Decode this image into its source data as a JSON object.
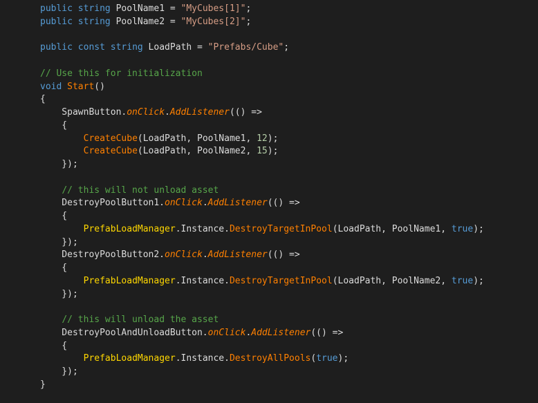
{
  "editor": {
    "theme": "dark",
    "colors": {
      "background": "#1e1e1e",
      "keyword": "#569cd6",
      "plain": "#dcdcdc",
      "string": "#d69d85",
      "comment": "#57a64a",
      "method": "#ff8000",
      "class": "#ffd700",
      "number": "#b5cea8"
    },
    "lines": [
      [
        {
          "t": "kw",
          "v": "public"
        },
        {
          "t": "plain",
          "v": " "
        },
        {
          "t": "kw",
          "v": "string"
        },
        {
          "t": "plain",
          "v": " PoolName1 = "
        },
        {
          "t": "str",
          "v": "\"MyCubes[1]\""
        },
        {
          "t": "plain",
          "v": ";"
        }
      ],
      [
        {
          "t": "kw",
          "v": "public"
        },
        {
          "t": "plain",
          "v": " "
        },
        {
          "t": "kw",
          "v": "string"
        },
        {
          "t": "plain",
          "v": " PoolName2 = "
        },
        {
          "t": "str",
          "v": "\"MyCubes[2]\""
        },
        {
          "t": "plain",
          "v": ";"
        }
      ],
      [],
      [
        {
          "t": "kw",
          "v": "public"
        },
        {
          "t": "plain",
          "v": " "
        },
        {
          "t": "kw",
          "v": "const"
        },
        {
          "t": "plain",
          "v": " "
        },
        {
          "t": "kw",
          "v": "string"
        },
        {
          "t": "plain",
          "v": " LoadPath = "
        },
        {
          "t": "str",
          "v": "\"Prefabs/Cube\""
        },
        {
          "t": "plain",
          "v": ";"
        }
      ],
      [],
      [
        {
          "t": "cmt",
          "v": "// Use this for initialization"
        }
      ],
      [
        {
          "t": "kw",
          "v": "void"
        },
        {
          "t": "plain",
          "v": " "
        },
        {
          "t": "method",
          "v": "Start"
        },
        {
          "t": "plain",
          "v": "()"
        }
      ],
      [
        {
          "t": "plain",
          "v": "{"
        }
      ],
      [
        {
          "t": "plain",
          "v": "    SpawnButton."
        },
        {
          "t": "event",
          "v": "onClick"
        },
        {
          "t": "plain",
          "v": "."
        },
        {
          "t": "event",
          "v": "AddListener"
        },
        {
          "t": "plain",
          "v": "(() =>"
        }
      ],
      [
        {
          "t": "plain",
          "v": "    {"
        }
      ],
      [
        {
          "t": "plain",
          "v": "        "
        },
        {
          "t": "method",
          "v": "CreateCube"
        },
        {
          "t": "plain",
          "v": "(LoadPath, PoolName1, "
        },
        {
          "t": "lit",
          "v": "12"
        },
        {
          "t": "plain",
          "v": ");"
        }
      ],
      [
        {
          "t": "plain",
          "v": "        "
        },
        {
          "t": "method",
          "v": "CreateCube"
        },
        {
          "t": "plain",
          "v": "(LoadPath, PoolName2, "
        },
        {
          "t": "lit",
          "v": "15"
        },
        {
          "t": "plain",
          "v": ");"
        }
      ],
      [
        {
          "t": "plain",
          "v": "    });"
        }
      ],
      [],
      [
        {
          "t": "plain",
          "v": "    "
        },
        {
          "t": "cmt",
          "v": "// this will not unload asset"
        }
      ],
      [
        {
          "t": "plain",
          "v": "    DestroyPoolButton1."
        },
        {
          "t": "event",
          "v": "onClick"
        },
        {
          "t": "plain",
          "v": "."
        },
        {
          "t": "event",
          "v": "AddListener"
        },
        {
          "t": "plain",
          "v": "(() =>"
        }
      ],
      [
        {
          "t": "plain",
          "v": "    {"
        }
      ],
      [
        {
          "t": "plain",
          "v": "        "
        },
        {
          "t": "cls",
          "v": "PrefabLoadManager"
        },
        {
          "t": "plain",
          "v": ".Instance."
        },
        {
          "t": "method",
          "v": "DestroyTargetInPool"
        },
        {
          "t": "plain",
          "v": "(LoadPath, PoolName1, "
        },
        {
          "t": "kw",
          "v": "true"
        },
        {
          "t": "plain",
          "v": ");"
        }
      ],
      [
        {
          "t": "plain",
          "v": "    });"
        }
      ],
      [
        {
          "t": "plain",
          "v": "    DestroyPoolButton2."
        },
        {
          "t": "event",
          "v": "onClick"
        },
        {
          "t": "plain",
          "v": "."
        },
        {
          "t": "event",
          "v": "AddListener"
        },
        {
          "t": "plain",
          "v": "(() =>"
        }
      ],
      [
        {
          "t": "plain",
          "v": "    {"
        }
      ],
      [
        {
          "t": "plain",
          "v": "        "
        },
        {
          "t": "cls",
          "v": "PrefabLoadManager"
        },
        {
          "t": "plain",
          "v": ".Instance."
        },
        {
          "t": "method",
          "v": "DestroyTargetInPool"
        },
        {
          "t": "plain",
          "v": "(LoadPath, PoolName2, "
        },
        {
          "t": "kw",
          "v": "true"
        },
        {
          "t": "plain",
          "v": ");"
        }
      ],
      [
        {
          "t": "plain",
          "v": "    });"
        }
      ],
      [],
      [
        {
          "t": "plain",
          "v": "    "
        },
        {
          "t": "cmt",
          "v": "// this will unload the asset"
        }
      ],
      [
        {
          "t": "plain",
          "v": "    DestroyPoolAndUnloadButton."
        },
        {
          "t": "event",
          "v": "onClick"
        },
        {
          "t": "plain",
          "v": "."
        },
        {
          "t": "event",
          "v": "AddListener"
        },
        {
          "t": "plain",
          "v": "(() =>"
        }
      ],
      [
        {
          "t": "plain",
          "v": "    {"
        }
      ],
      [
        {
          "t": "plain",
          "v": "        "
        },
        {
          "t": "cls",
          "v": "PrefabLoadManager"
        },
        {
          "t": "plain",
          "v": ".Instance."
        },
        {
          "t": "method",
          "v": "DestroyAllPools"
        },
        {
          "t": "plain",
          "v": "("
        },
        {
          "t": "kw",
          "v": "true"
        },
        {
          "t": "plain",
          "v": ");"
        }
      ],
      [
        {
          "t": "plain",
          "v": "    });"
        }
      ],
      [
        {
          "t": "plain",
          "v": "}"
        }
      ]
    ]
  }
}
